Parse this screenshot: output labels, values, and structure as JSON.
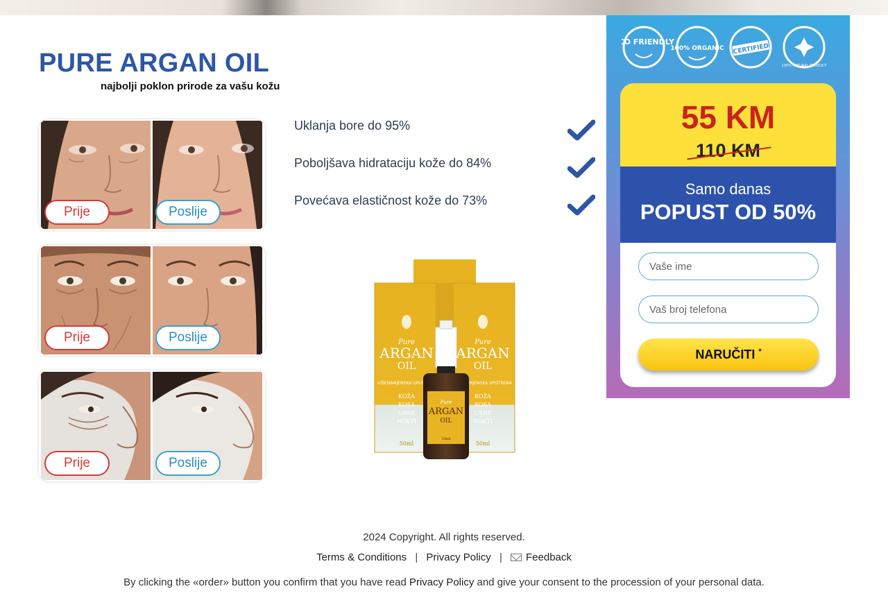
{
  "brand": {
    "title": "PURE ARGAN OIL",
    "subtitle": "najbolji poklon prirode za vašu kožu"
  },
  "before_after": [
    {
      "before_label": "Prije",
      "after_label": "Poslije"
    },
    {
      "before_label": "Prije",
      "after_label": "Poslije"
    },
    {
      "before_label": "Prije",
      "after_label": "Poslije"
    }
  ],
  "benefits": [
    "Uklanja bore do 95%",
    "Poboljšava hidrataciju kože do 84%",
    "Povećava elastičnost kože do 73%"
  ],
  "product": {
    "box_text_brand": "Pure",
    "box_text_main": "ARGAN",
    "box_text_sub": "OIL",
    "box_usage": "VIŠENAMJENSKA UPOTREBA",
    "box_items": [
      "KOŽA",
      "KOSA",
      "USNE",
      "NOKTI"
    ],
    "volume": "50ml"
  },
  "badges": [
    "ECO FRIENDLY",
    "100% ORGANIC",
    "CERTIFIED",
    "100% NATURAL PRODUCT"
  ],
  "offer": {
    "new_price": "55 KM",
    "old_price": "110 KM",
    "promo_line1": "Samo danas",
    "promo_line2": "POPUST OD 50%",
    "name_placeholder": "Vaše ime",
    "phone_placeholder": "Vaš broj telefona",
    "order_label": "NARUČITI",
    "order_mark": "*"
  },
  "colors": {
    "brand_blue": "#2d56a6",
    "price_red": "#c9231d",
    "promo_blue": "#2c52ac",
    "highlight_yellow": "#fde13a"
  },
  "footer": {
    "copyright": "2024 Copyright. All rights reserved.",
    "terms": "Terms & Conditions",
    "privacy": "Privacy Policy",
    "feedback": "Feedback",
    "consent_prefix": "By clicking the «order» button you confirm that you have read ",
    "consent_link": "Privacy Policy",
    "consent_suffix": " and give your consent to the procession of your personal data."
  }
}
